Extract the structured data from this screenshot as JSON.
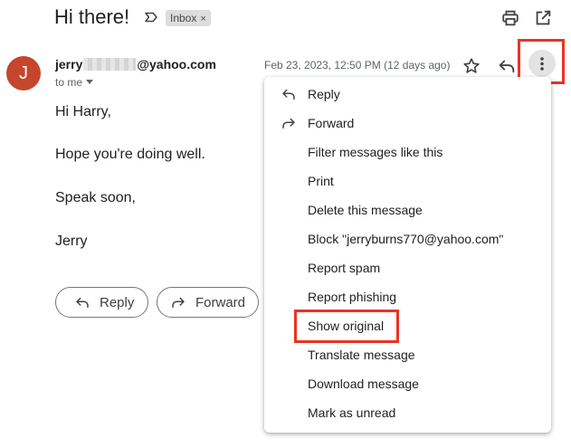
{
  "email": {
    "subject": "Hi there!",
    "label_chip": "Inbox",
    "label_remove_glyph": "×",
    "sender_prefix": "jerry",
    "sender_suffix": "@yahoo.com",
    "recipient_line": "to me",
    "date": "Feb 23, 2023, 12:50 PM (12 days ago)",
    "avatar_letter": "J",
    "avatar_color": "#c5462b",
    "body": [
      "Hi Harry,",
      "Hope you're doing well.",
      "Speak soon,",
      "Jerry"
    ]
  },
  "actions": {
    "reply_label": "Reply",
    "forward_label": "Forward"
  },
  "menu": {
    "items": [
      {
        "label": "Reply",
        "icon": "reply-icon"
      },
      {
        "label": "Forward",
        "icon": "forward-icon"
      },
      {
        "label": "Filter messages like this",
        "icon": ""
      },
      {
        "label": "Print",
        "icon": ""
      },
      {
        "label": "Delete this message",
        "icon": ""
      },
      {
        "label": "Block \"jerryburns770@yahoo.com\"",
        "icon": ""
      },
      {
        "label": "Report spam",
        "icon": ""
      },
      {
        "label": "Report phishing",
        "icon": ""
      },
      {
        "label": "Show original",
        "icon": ""
      },
      {
        "label": "Translate message",
        "icon": ""
      },
      {
        "label": "Download message",
        "icon": ""
      },
      {
        "label": "Mark as unread",
        "icon": ""
      }
    ]
  },
  "highlight_color": "#ea3323"
}
